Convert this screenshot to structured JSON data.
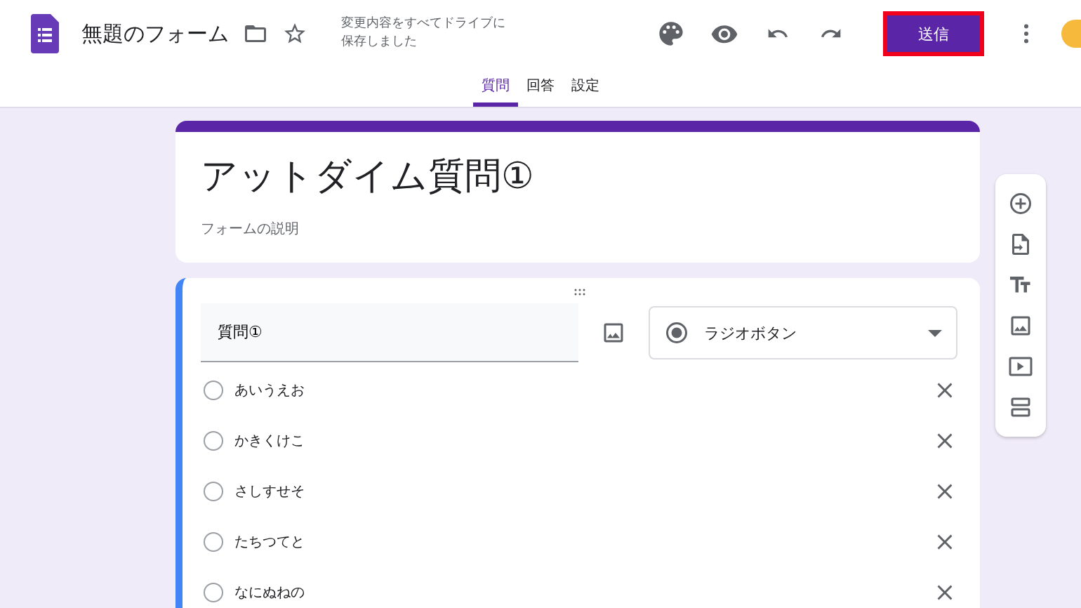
{
  "header": {
    "title": "無題のフォーム",
    "save_status": [
      "変更内容をすべてドライブに",
      "保存しました"
    ],
    "send_button": {
      "label": "送信",
      "highlighted": true
    }
  },
  "tabs": [
    {
      "label": "質問",
      "selected": true
    },
    {
      "label": "回答",
      "selected": false
    },
    {
      "label": "設定",
      "selected": false
    }
  ],
  "form_header": {
    "title": "アットダイム質問①",
    "description": "フォームの説明"
  },
  "question": {
    "title": "質問①",
    "type": "ラジオボタン",
    "options": [
      {
        "label": "あいうえお"
      },
      {
        "label": "かきくけこ"
      },
      {
        "label": "さしすせそ"
      },
      {
        "label": "たちつてと"
      },
      {
        "label": "なにぬねの"
      }
    ]
  }
}
